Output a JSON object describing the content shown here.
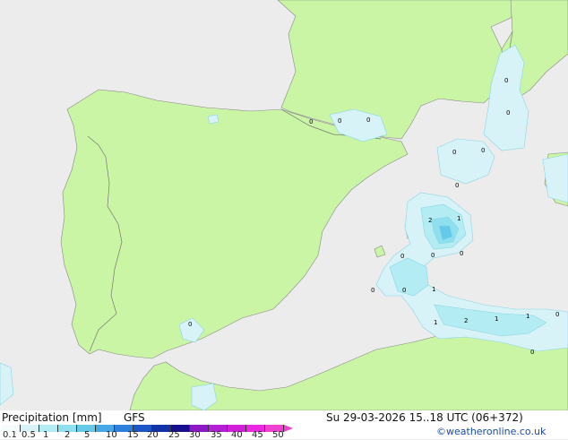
{
  "legend": {
    "title": "Precipitation [mm]",
    "model": "GFS",
    "ticks": [
      "0.1",
      "0.5",
      "1",
      "2",
      "5",
      "10",
      "15",
      "20",
      "25",
      "30",
      "35",
      "40",
      "45",
      "50"
    ],
    "colors": [
      "#f5fbfb",
      "#d7f3f7",
      "#b4ecf3",
      "#8ee0ee",
      "#65c9ea",
      "#46a7e6",
      "#2e7fdc",
      "#1d56c9",
      "#1232a8",
      "#180f8e",
      "#8c18c6",
      "#b41ed6",
      "#d31fd9",
      "#ec27e2",
      "#f040cf"
    ]
  },
  "valid_time": "Su 29-03-2026 15..18 UTC (06+372)",
  "credit": "©weatheronline.co.uk",
  "map_colors": {
    "sea": "#ececec",
    "land": "#c9f5a4",
    "border": "#777777",
    "coast": "#888888"
  },
  "precip_labels": [
    "0",
    "0",
    "0",
    "0",
    "0",
    "0",
    "0",
    "0",
    "2",
    "1",
    "0",
    "0",
    "0",
    "0",
    "1",
    "1",
    "2",
    "1",
    "1",
    "0",
    "0",
    "0",
    "0"
  ]
}
